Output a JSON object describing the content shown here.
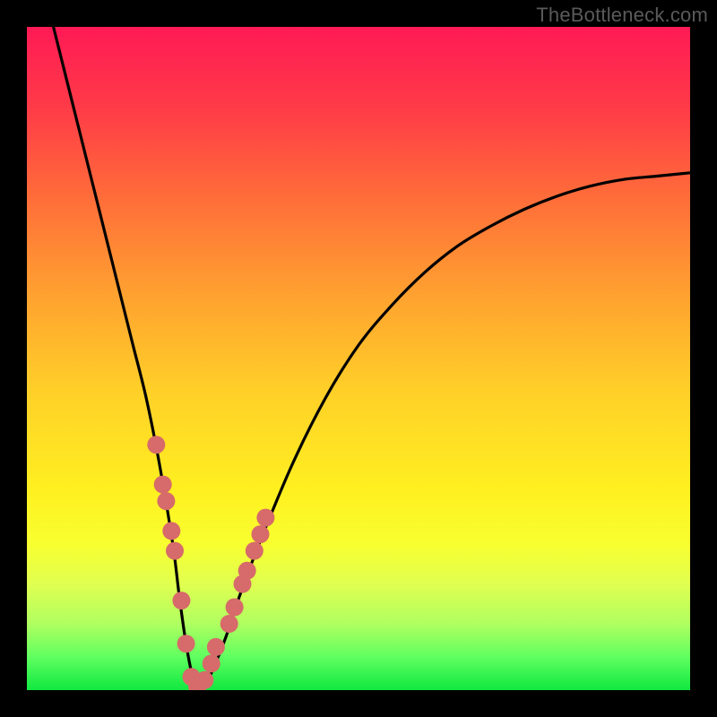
{
  "watermark": "TheBottleneck.com",
  "chart_data": {
    "type": "line",
    "title": "",
    "xlabel": "",
    "ylabel": "",
    "xlim": [
      0,
      100
    ],
    "ylim": [
      0,
      100
    ],
    "series": [
      {
        "name": "bottleneck-curve",
        "x": [
          4,
          6,
          8,
          10,
          12,
          14,
          16,
          18,
          20,
          22,
          23,
          24,
          25,
          26,
          27,
          28,
          30,
          32,
          35,
          40,
          45,
          50,
          55,
          60,
          65,
          70,
          75,
          80,
          85,
          90,
          95,
          100
        ],
        "values": [
          100,
          92,
          84,
          76,
          68,
          60,
          52,
          44,
          34,
          22,
          14,
          7,
          2,
          0,
          1,
          3,
          8,
          14,
          22,
          34,
          44,
          52,
          58,
          63,
          67,
          70,
          72.5,
          74.5,
          76,
          77,
          77.5,
          78
        ]
      }
    ],
    "markers": {
      "name": "highlight-points",
      "color": "#d76a6a",
      "x": [
        19.5,
        20.5,
        21.0,
        21.8,
        22.3,
        23.3,
        24.0,
        24.8,
        25.7,
        26.8,
        27.8,
        28.5,
        30.5,
        31.3,
        32.5,
        33.2,
        34.3,
        35.2,
        36.0
      ],
      "y": [
        37,
        31,
        28.5,
        24,
        21,
        13.5,
        7,
        2,
        0.5,
        1.5,
        4,
        6.5,
        10,
        12.5,
        16,
        18,
        21,
        23.5,
        26
      ]
    },
    "gradient": {
      "top_color": "#ff1a55",
      "mid_color": "#ffd028",
      "bottom_color": "#10e840"
    }
  }
}
